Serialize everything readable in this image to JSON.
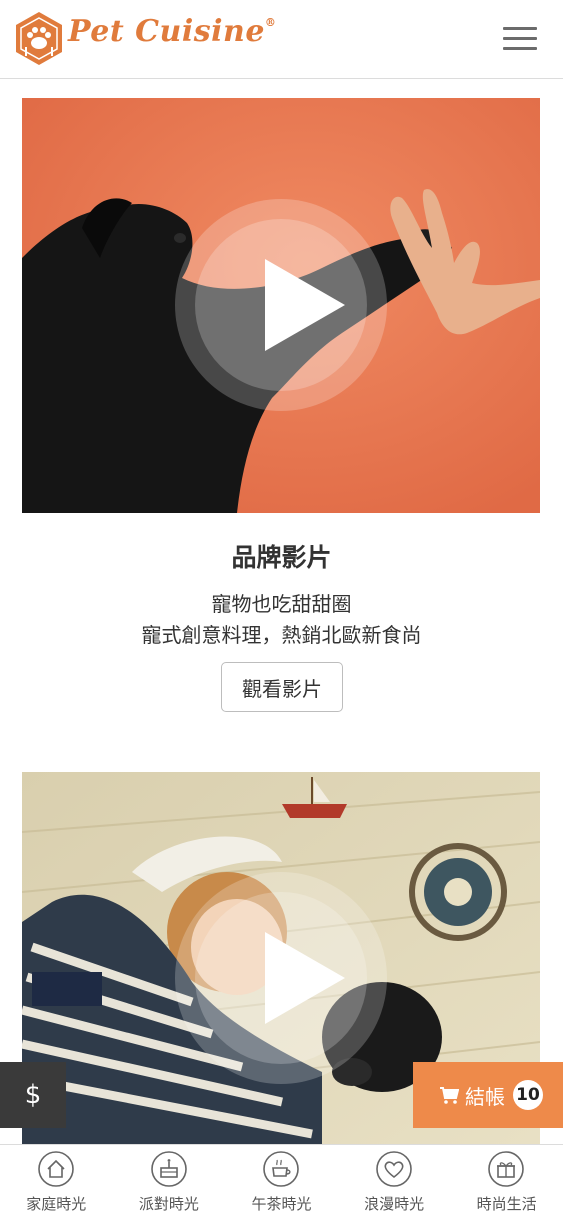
{
  "header": {
    "brand": "Pet Cuisine",
    "registered_mark": "®",
    "logo_icon": "paw-fork-hexagon-icon",
    "menu_icon": "hamburger-icon"
  },
  "videos": [
    {
      "scene": "black dog giving high-five to human hand on orange background",
      "play_icon": "play-icon"
    },
    {
      "scene": "child in striped shirt lying with puppy on wooden floor with toy boat and ship wheel",
      "play_icon": "play-icon"
    }
  ],
  "brand_section": {
    "title": "品牌影片",
    "line1": "寵物也吃甜甜圈",
    "line2": "寵式創意料理，熱銷北歐新食尚",
    "button_label": "觀看影片"
  },
  "floating": {
    "price_symbol": "$",
    "checkout_label": "結帳",
    "cart_count": "10",
    "cart_icon": "cart-icon"
  },
  "bottom_nav": [
    {
      "label": "家庭時光",
      "icon": "house-icon"
    },
    {
      "label": "派對時光",
      "icon": "cake-icon"
    },
    {
      "label": "午茶時光",
      "icon": "teacup-icon"
    },
    {
      "label": "浪漫時光",
      "icon": "heart-icon"
    },
    {
      "label": "時尚生活",
      "icon": "gift-icon"
    }
  ],
  "colors": {
    "brand_orange": "#e07b3c",
    "checkout_orange": "#ee8a4a",
    "dark_button": "#3a3a3a",
    "video1_background": "#e8734f"
  }
}
